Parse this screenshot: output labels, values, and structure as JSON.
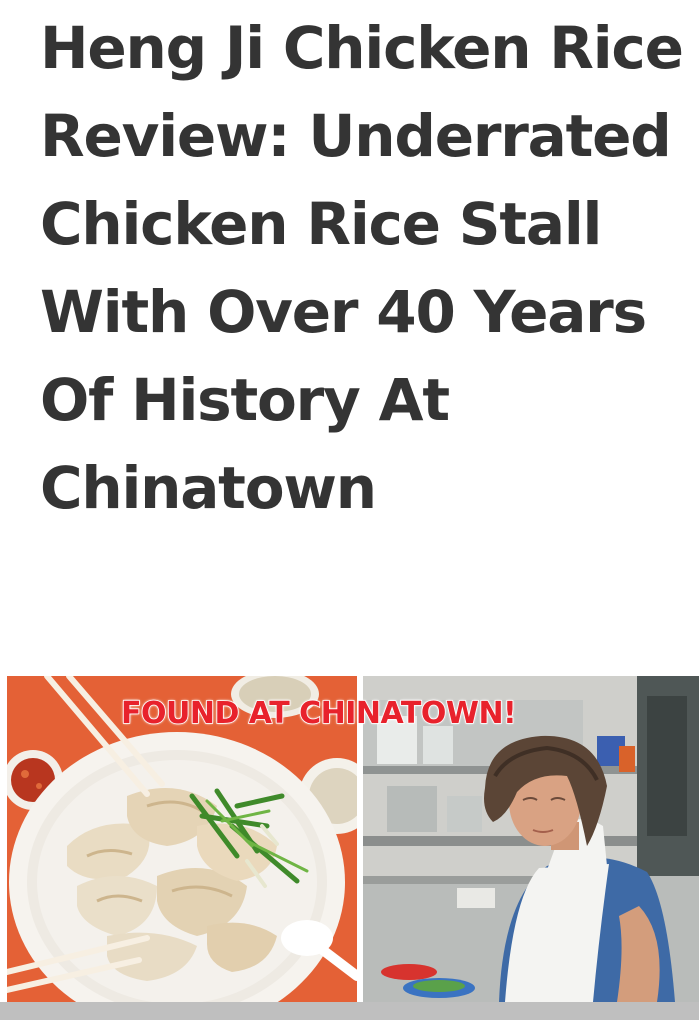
{
  "article": {
    "title": "Heng Ji Chicken Rice Review: Underrated Chicken Rice Stall With Over 40 Years Of History At Chinatown"
  },
  "hero_image": {
    "banner_text": "FOUND AT CHINATOWN!"
  },
  "colors": {
    "title_text": "#343434",
    "banner_text": "#e8222c",
    "left_panel_background": "#e9673a",
    "bottom_bar": "#bfbfbf"
  }
}
